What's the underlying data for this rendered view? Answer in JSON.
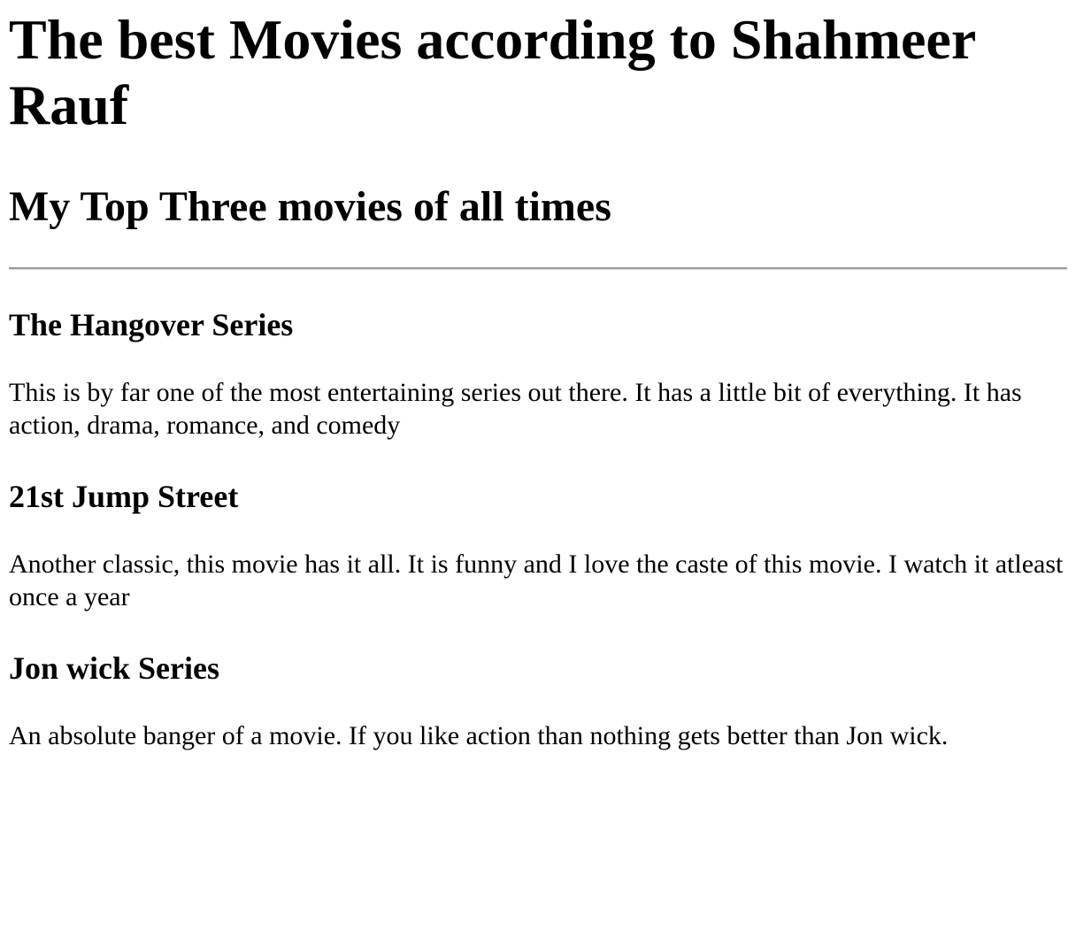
{
  "page": {
    "title": "The best Movies according to Shahmeer Rauf",
    "subtitle": "My Top Three movies of all times"
  },
  "movies": [
    {
      "title": "The Hangover Series",
      "description": "This is by far one of the most entertaining series out there. It has a little bit of everything. It has action, drama, romance, and comedy"
    },
    {
      "title": "21st Jump Street",
      "description": "Another classic, this movie has it all. It is funny and I love the caste of this movie. I watch it atleast once a year"
    },
    {
      "title": "Jon wick Series",
      "description": "An absolute banger of a movie. If you like action than nothing gets better than Jon wick."
    }
  ],
  "colors": {
    "background": "#ffffff",
    "text": "#000000",
    "divider": "#9a9a9a"
  }
}
